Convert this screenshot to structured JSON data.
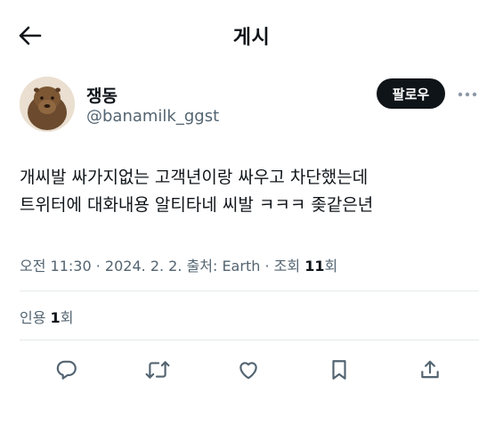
{
  "header": {
    "title": "게시",
    "back_icon": "arrow-left-icon"
  },
  "author": {
    "display_name": "쟁동",
    "handle": "@banamilk_ggst",
    "follow_label": "팔로우",
    "more_icon": "ellipsis-icon"
  },
  "tweet": {
    "lines": [
      "개씨발 싸가지없는 고객년이랑 싸우고 차단했는데",
      "트위터에 대화내용 알티타네 씨발 ㅋㅋㅋ 좆같은년"
    ]
  },
  "meta": {
    "time": "오전 11:30",
    "date": "2024. 2. 2.",
    "source": "출처: Earth",
    "views_label": "조회",
    "views_count": "11",
    "views_unit": "회",
    "separator": "·"
  },
  "quotes": {
    "label": "인용",
    "count": "1",
    "unit": "회"
  },
  "actions": {
    "reply_icon": "reply-icon",
    "retweet_icon": "retweet-icon",
    "like_icon": "heart-icon",
    "bookmark_icon": "bookmark-icon",
    "share_icon": "share-icon"
  },
  "colors": {
    "text": "#0f1419",
    "secondary": "#536471",
    "divider": "#e6e9ec",
    "button_bg": "#0f1419"
  }
}
